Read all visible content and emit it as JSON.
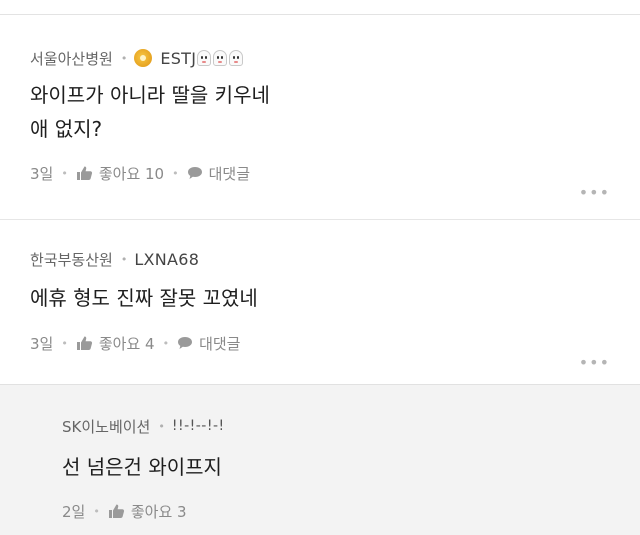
{
  "comments": [
    {
      "company": "서울아산병원",
      "nickname": "ESTJ",
      "body_lines": [
        "와이프가 아니라 딸을 키우네",
        "애 없지?"
      ],
      "time": "3일",
      "like_label": "좋아요 10",
      "reply_label": "대댓글",
      "icons": [
        "coin-badge-icon",
        "ghost-emoji-icon",
        "thumb-up-icon",
        "comment-bubble-icon",
        "more-icon"
      ]
    },
    {
      "company": "한국부동산원",
      "nickname": "LXNA68",
      "body_lines": [
        "에휴 형도 진짜 잘못 꼬였네"
      ],
      "time": "3일",
      "like_label": "좋아요 4",
      "reply_label": "대댓글",
      "icons": [
        "thumb-up-icon",
        "comment-bubble-icon",
        "more-icon"
      ]
    }
  ],
  "reply": {
    "company": "SK이노베이션",
    "nickname": "!!-!--!-!",
    "body_lines": [
      "선 넘은건 와이프지"
    ],
    "time": "2일",
    "like_label": "좋아요 3",
    "icons": [
      "thumb-up-icon"
    ]
  },
  "colors": {
    "reply_background": "#f3f3f3",
    "meta_text": "#666666",
    "action_text": "#8a8a8a",
    "divider": "#e6e6e6"
  }
}
